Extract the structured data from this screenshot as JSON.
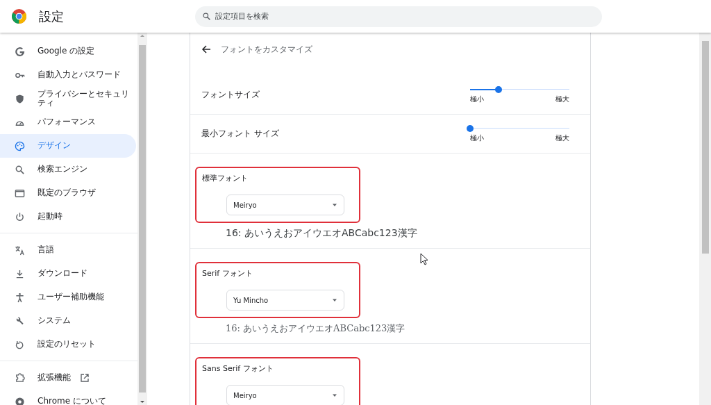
{
  "header": {
    "title": "設定",
    "search": {
      "placeholder": "設定項目を検索"
    }
  },
  "sidebar": {
    "groups": [
      {
        "items": [
          {
            "label": "Google の設定",
            "kind": "google",
            "selected": false
          },
          {
            "label": "自動入力とパスワード",
            "kind": "key",
            "selected": false
          },
          {
            "label": "プライバシーとセキュリティ",
            "kind": "shield",
            "selected": false
          },
          {
            "label": "パフォーマンス",
            "kind": "gauge",
            "selected": false
          },
          {
            "label": "デザイン",
            "kind": "palette",
            "selected": true
          },
          {
            "label": "検索エンジン",
            "kind": "search",
            "selected": false
          },
          {
            "label": "既定のブラウザ",
            "kind": "window",
            "selected": false
          },
          {
            "label": "起動時",
            "kind": "power",
            "selected": false
          }
        ]
      },
      {
        "items": [
          {
            "label": "言語",
            "kind": "translate",
            "selected": false
          },
          {
            "label": "ダウンロード",
            "kind": "download",
            "selected": false
          },
          {
            "label": "ユーザー補助機能",
            "kind": "person",
            "selected": false
          },
          {
            "label": "システム",
            "kind": "wrench",
            "selected": false
          },
          {
            "label": "設定のリセット",
            "kind": "reset",
            "selected": false
          }
        ]
      },
      {
        "items": [
          {
            "label": "拡張機能",
            "kind": "puzzle",
            "selected": false,
            "external": true
          },
          {
            "label": "Chrome について",
            "kind": "chrome",
            "selected": false
          }
        ]
      }
    ]
  },
  "page": {
    "title": "フォントをカスタマイズ",
    "sliders": [
      {
        "label": "フォントサイズ",
        "level": 0.29,
        "min_label": "極小",
        "max_label": "極大"
      },
      {
        "label": "最小フォント サイズ",
        "level": 0,
        "min_label": "極小",
        "max_label": "極大"
      }
    ],
    "fonts": [
      {
        "label": "標準フォント",
        "value": "Meiryo",
        "sample": "16: あいうえおアイウエオABCabc123漢字",
        "kind": "sans",
        "highlighted": true
      },
      {
        "label": "Serif フォント",
        "value": "Yu Mincho",
        "sample": "16: あいうえおアイウエオABCabc123漢字",
        "kind": "serif",
        "highlighted": true
      },
      {
        "label": "Sans Serif フォント",
        "value": "Meiryo",
        "highlighted": true
      }
    ]
  }
}
